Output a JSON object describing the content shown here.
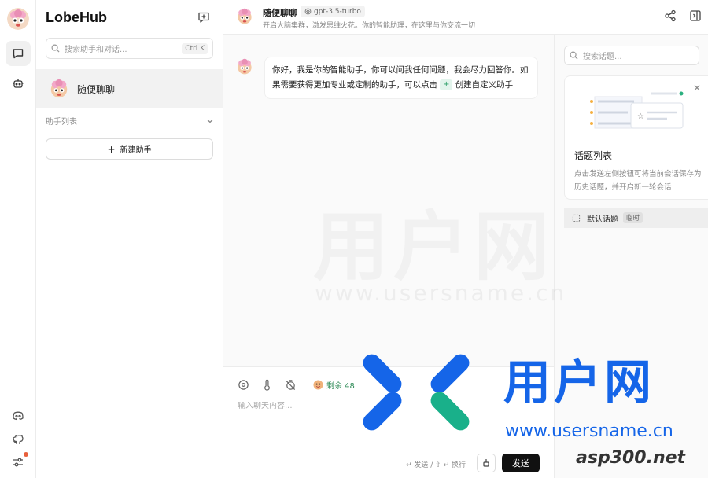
{
  "app": {
    "brand": "LobeHub"
  },
  "sidebar": {
    "search_placeholder": "搜索助手和对话...",
    "search_shortcut": "Ctrl K",
    "session": {
      "name": "随便聊聊"
    },
    "group_label": "助手列表",
    "new_assistant_label": "新建助手"
  },
  "header": {
    "title": "随便聊聊",
    "model": "gpt-3.5-turbo",
    "description": "开启大脑集群，激发思维火花。你的智能助理，在这里与你交流一切"
  },
  "messages": [
    {
      "role": "assistant",
      "text_before": "你好，我是你的智能助手，你可以问我任何问题，我会尽力回答你。如果需要获得更加专业或定制的助手，可以点击",
      "inline_icon": "+",
      "text_after": "创建自定义助手"
    }
  ],
  "input": {
    "placeholder": "输入聊天内容...",
    "quota_label": "剩余 48",
    "hint": "↵ 发送 / ⇧ ↵ 换行",
    "send_label": "发送"
  },
  "topics": {
    "search_placeholder": "搜索话题...",
    "guide_title": "话题列表",
    "guide_desc": "点击发送左侧按钮可将当前会话保存为历史话题，并开启新一轮会话",
    "default_topic": "默认话题",
    "default_badge": "临时"
  },
  "watermark": {
    "big_text": "用户网",
    "url_text": "www.usersname.cn",
    "logo_text": "用户网",
    "logo_url": "www.usersname.cn",
    "logo_sub": "asp300.net"
  },
  "colors": {
    "accent": "#111111",
    "quota_green": "#2e8b57",
    "notice_dot": "#e8603c",
    "brand_blue": "#1565e8",
    "brand_teal": "#19b08a"
  },
  "icons": {
    "chat": "chat-bubble-icon",
    "assistant": "robot-icon",
    "discord": "discord-icon",
    "github": "github-icon",
    "settings": "sliders-icon",
    "share": "share-icon",
    "panel": "panel-toggle-icon"
  }
}
